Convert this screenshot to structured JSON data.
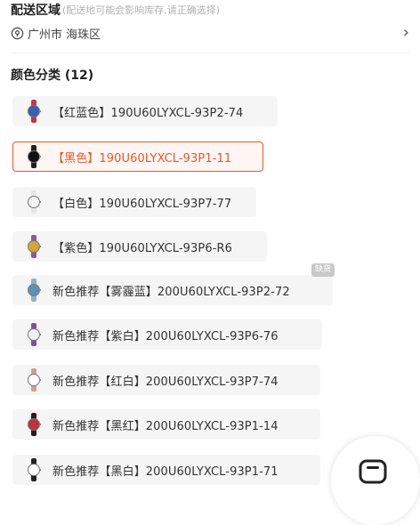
{
  "region": {
    "title": "配送区域",
    "hint": "(配送地可能会影响库存,请正确选择)",
    "address": "广州市 海珠区",
    "pin_icon": "location-pin-icon",
    "chevron": "›"
  },
  "colors": {
    "heading": "颜色分类 (12)",
    "selected_index": 1,
    "accent": "#e6572a",
    "items": [
      {
        "label": "【红蓝色】190U60LYXCL-93P2-74",
        "strap": "#c8324a",
        "face": "#3a5fb0"
      },
      {
        "label": "【黑色】190U60LYXCL-93P1-11",
        "strap": "#1f1f1f",
        "face": "#111111"
      },
      {
        "label": "【白色】190U60LYXCL-93P7-77",
        "strap": "#e6e6e6",
        "face": "#f4f4f4"
      },
      {
        "label": "【紫色】190U60LYXCL-93P6-R6",
        "strap": "#8a5a9a",
        "face": "#d8a33a"
      },
      {
        "label": "新色推荐【雾霾蓝】200U60LYXCL-93P2-72",
        "strap": "#8fb0c8",
        "face": "#5e8fb5"
      },
      {
        "label": "新色推荐【紫白】200U60LYXCL-93P6-76",
        "strap": "#7f4fa8",
        "face": "#f0f0f0"
      },
      {
        "label": "新色推荐【红白】200U60LYXCL-93P7-74",
        "strap": "#d49a9a",
        "face": "#ffffff"
      },
      {
        "label": "新色推荐【黑红】200U60LYXCL-93P1-14",
        "strap": "#2a1a1a",
        "face": "#c03040"
      },
      {
        "label": "新色推荐【黑白】200U60LYXCL-93P1-71",
        "strap": "#222222",
        "face": "#ffffff"
      }
    ],
    "badge": "缺货",
    "badge_index": 4
  },
  "floating_button": {
    "icon": "watch-outline-icon"
  }
}
